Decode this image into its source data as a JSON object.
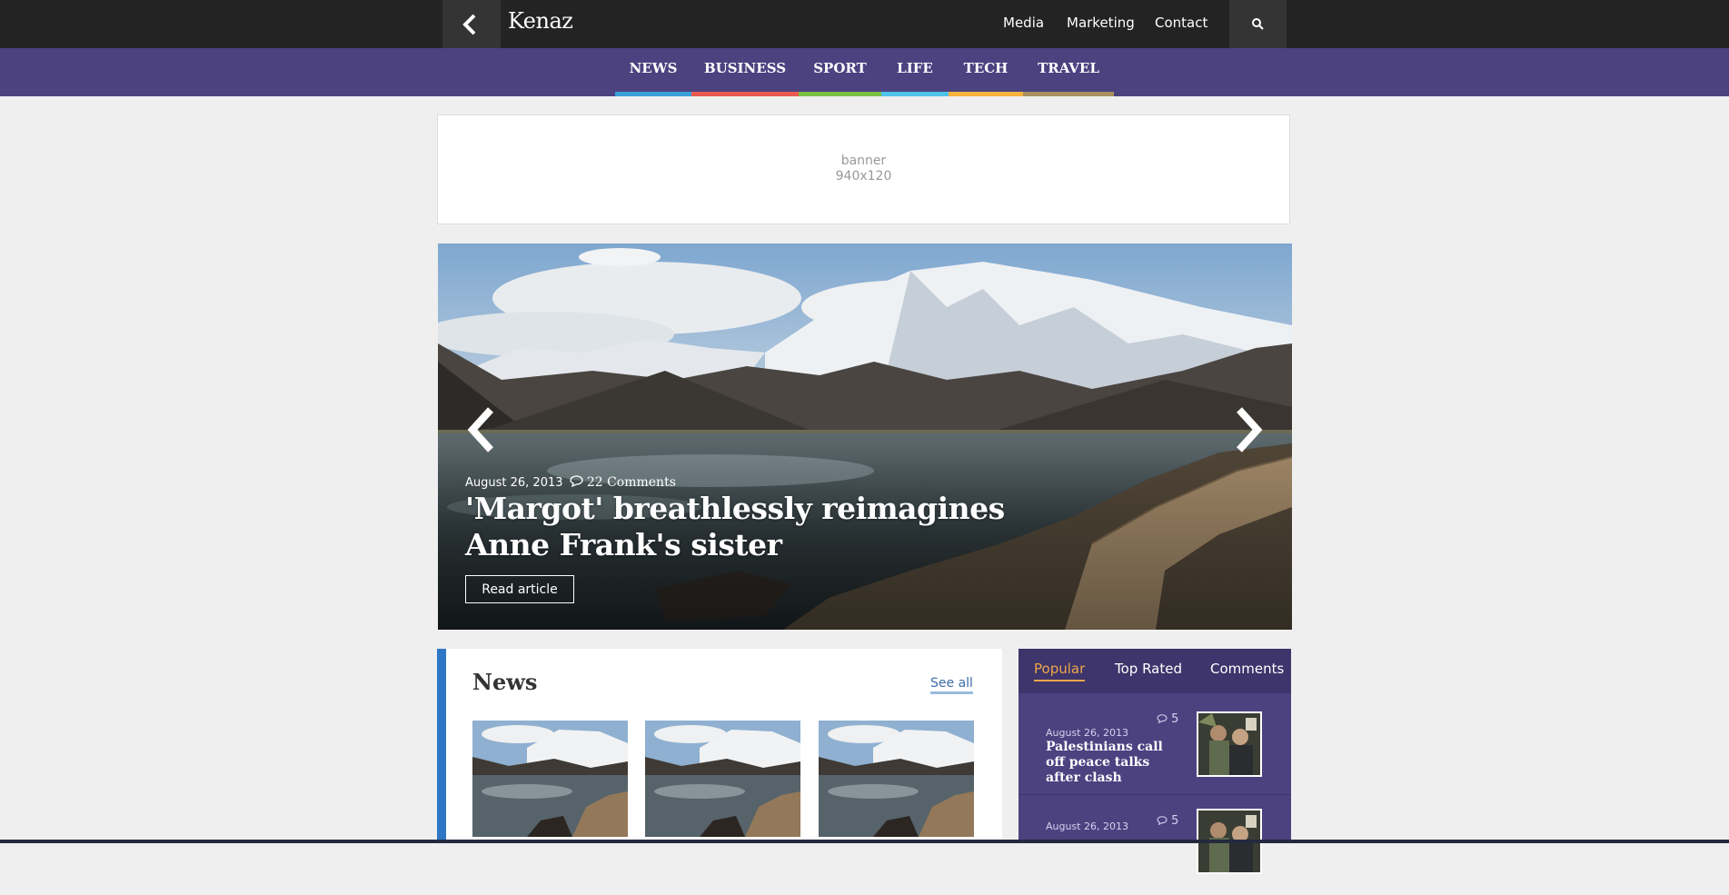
{
  "header": {
    "logo": "Kenaz",
    "nav": [
      "Media",
      "Marketing",
      "Contact"
    ]
  },
  "categories": [
    {
      "label": "NEWS",
      "color": "#3aa0d8"
    },
    {
      "label": "BUSINESS",
      "color": "#e8594f"
    },
    {
      "label": "SPORT",
      "color": "#7cbf43"
    },
    {
      "label": "LIFE",
      "color": "#4fc3ea"
    },
    {
      "label": "TECH",
      "color": "#f7b33c"
    },
    {
      "label": "TRAVEL",
      "color": "#a8905e"
    }
  ],
  "banner": {
    "line1": "banner",
    "line2": "940x120"
  },
  "hero": {
    "date": "August 26, 2013",
    "comments": "22 Comments",
    "title": "'Margot' breathlessly reimagines Anne Frank's sister",
    "button": "Read article"
  },
  "news": {
    "title": "News",
    "see_all": "See all",
    "accent": "#2f77c4"
  },
  "sidebar": {
    "tabs": [
      "Popular",
      "Top Rated",
      "Comments"
    ],
    "active_tab": "Popular",
    "items": [
      {
        "date": "August 26, 2013",
        "title": "Palestinians call off peace talks after clash",
        "comments": "5"
      },
      {
        "date": "August 26, 2013",
        "title": "",
        "comments": "5"
      }
    ]
  },
  "icons": [
    "back-chevron-icon",
    "search-icon",
    "prev-arrow-icon",
    "next-arrow-icon",
    "comment-icon"
  ]
}
